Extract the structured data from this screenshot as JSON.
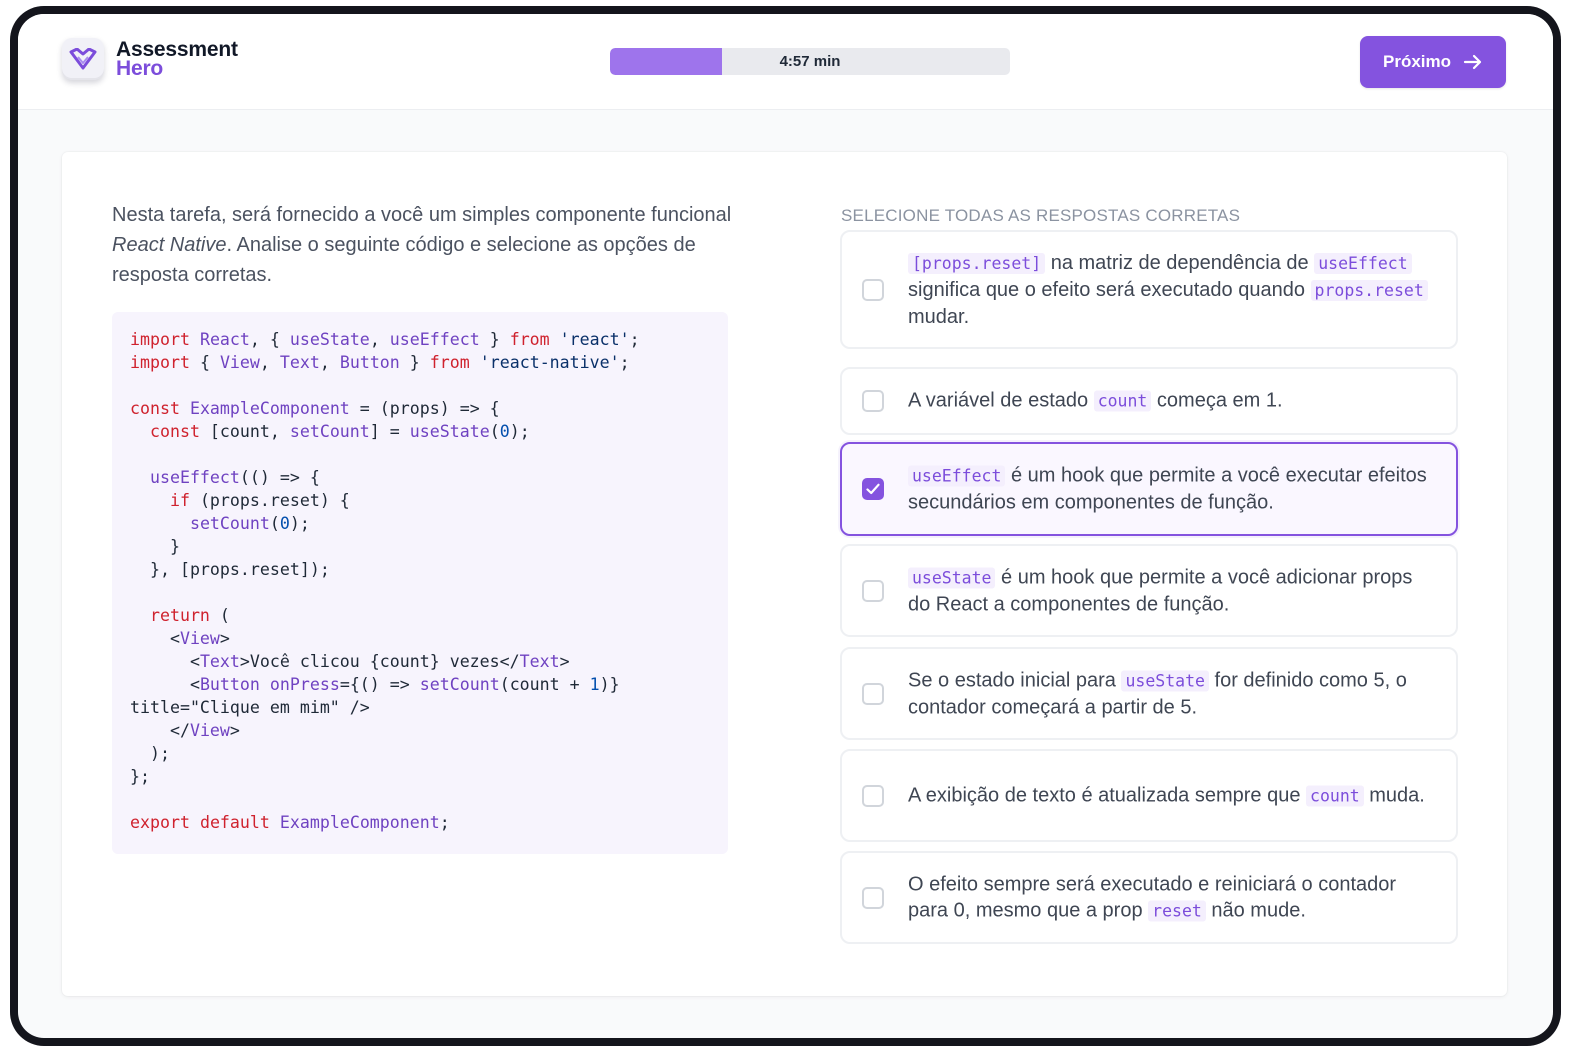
{
  "app": {
    "logo_line1": "Assessment",
    "logo_line2": "Hero",
    "accent_color": "#8453df"
  },
  "header": {
    "timer_label": "4:57 min",
    "timer_progress": 0.28,
    "next_label": "Próximo"
  },
  "question": {
    "prompt_part1": "Nesta tarefa, será fornecido a você um simples componente funcional ",
    "prompt_em": "React Native",
    "prompt_part2": ". Analise o seguinte código e selecione as opções de resposta corretas.",
    "code_lines": [
      "import React, { useState, useEffect } from 'react';",
      "import { View, Text, Button } from 'react-native';",
      "",
      "const ExampleComponent = (props) => {",
      "  const [count, setCount] = useState(0);",
      "",
      "  useEffect(() => {",
      "    if (props.reset) {",
      "      setCount(0);",
      "    }",
      "  }, [props.reset]);",
      "",
      "  return (",
      "    <View>",
      "      <Text>Você clicou {count} vezes</Text>",
      "      <Button onPress={() => setCount(count + 1)}",
      "title=\"Clique em mim\" />",
      "    </View>",
      "  );",
      "};",
      "",
      "export default ExampleComponent;"
    ]
  },
  "answers": {
    "heading": "SELECIONE TODAS AS RESPOSTAS CORRETAS",
    "options": [
      {
        "checked": false,
        "segments": [
          {
            "code": "[props.reset]"
          },
          {
            "text": " na matriz de dependência de "
          },
          {
            "code": "useEffect"
          },
          {
            "text": " significa que o efeito será executado quando "
          },
          {
            "code": "props.reset"
          },
          {
            "text": " mudar."
          }
        ]
      },
      {
        "checked": false,
        "segments": [
          {
            "text": "A variável de estado "
          },
          {
            "code": "count"
          },
          {
            "text": " começa em 1."
          }
        ]
      },
      {
        "checked": true,
        "segments": [
          {
            "code": "useEffect"
          },
          {
            "text": " é um hook que permite a você executar efeitos secundários em componentes de função."
          }
        ]
      },
      {
        "checked": false,
        "segments": [
          {
            "code": "useState"
          },
          {
            "text": " é um hook que permite a você adicionar props do React a componentes de função."
          }
        ]
      },
      {
        "checked": false,
        "segments": [
          {
            "text": "Se o estado inicial para "
          },
          {
            "code": "useState"
          },
          {
            "text": " for definido como 5, o contador começará a partir de 5."
          }
        ]
      },
      {
        "checked": false,
        "segments": [
          {
            "text": "A exibição de texto é atualizada sempre que "
          },
          {
            "code": "count"
          },
          {
            "text": " muda."
          }
        ]
      },
      {
        "checked": false,
        "segments": [
          {
            "text": "O efeito sempre será executado e reiniciará o contador para 0, mesmo que a prop "
          },
          {
            "code": "reset"
          },
          {
            "text": " não mude."
          }
        ]
      }
    ]
  }
}
